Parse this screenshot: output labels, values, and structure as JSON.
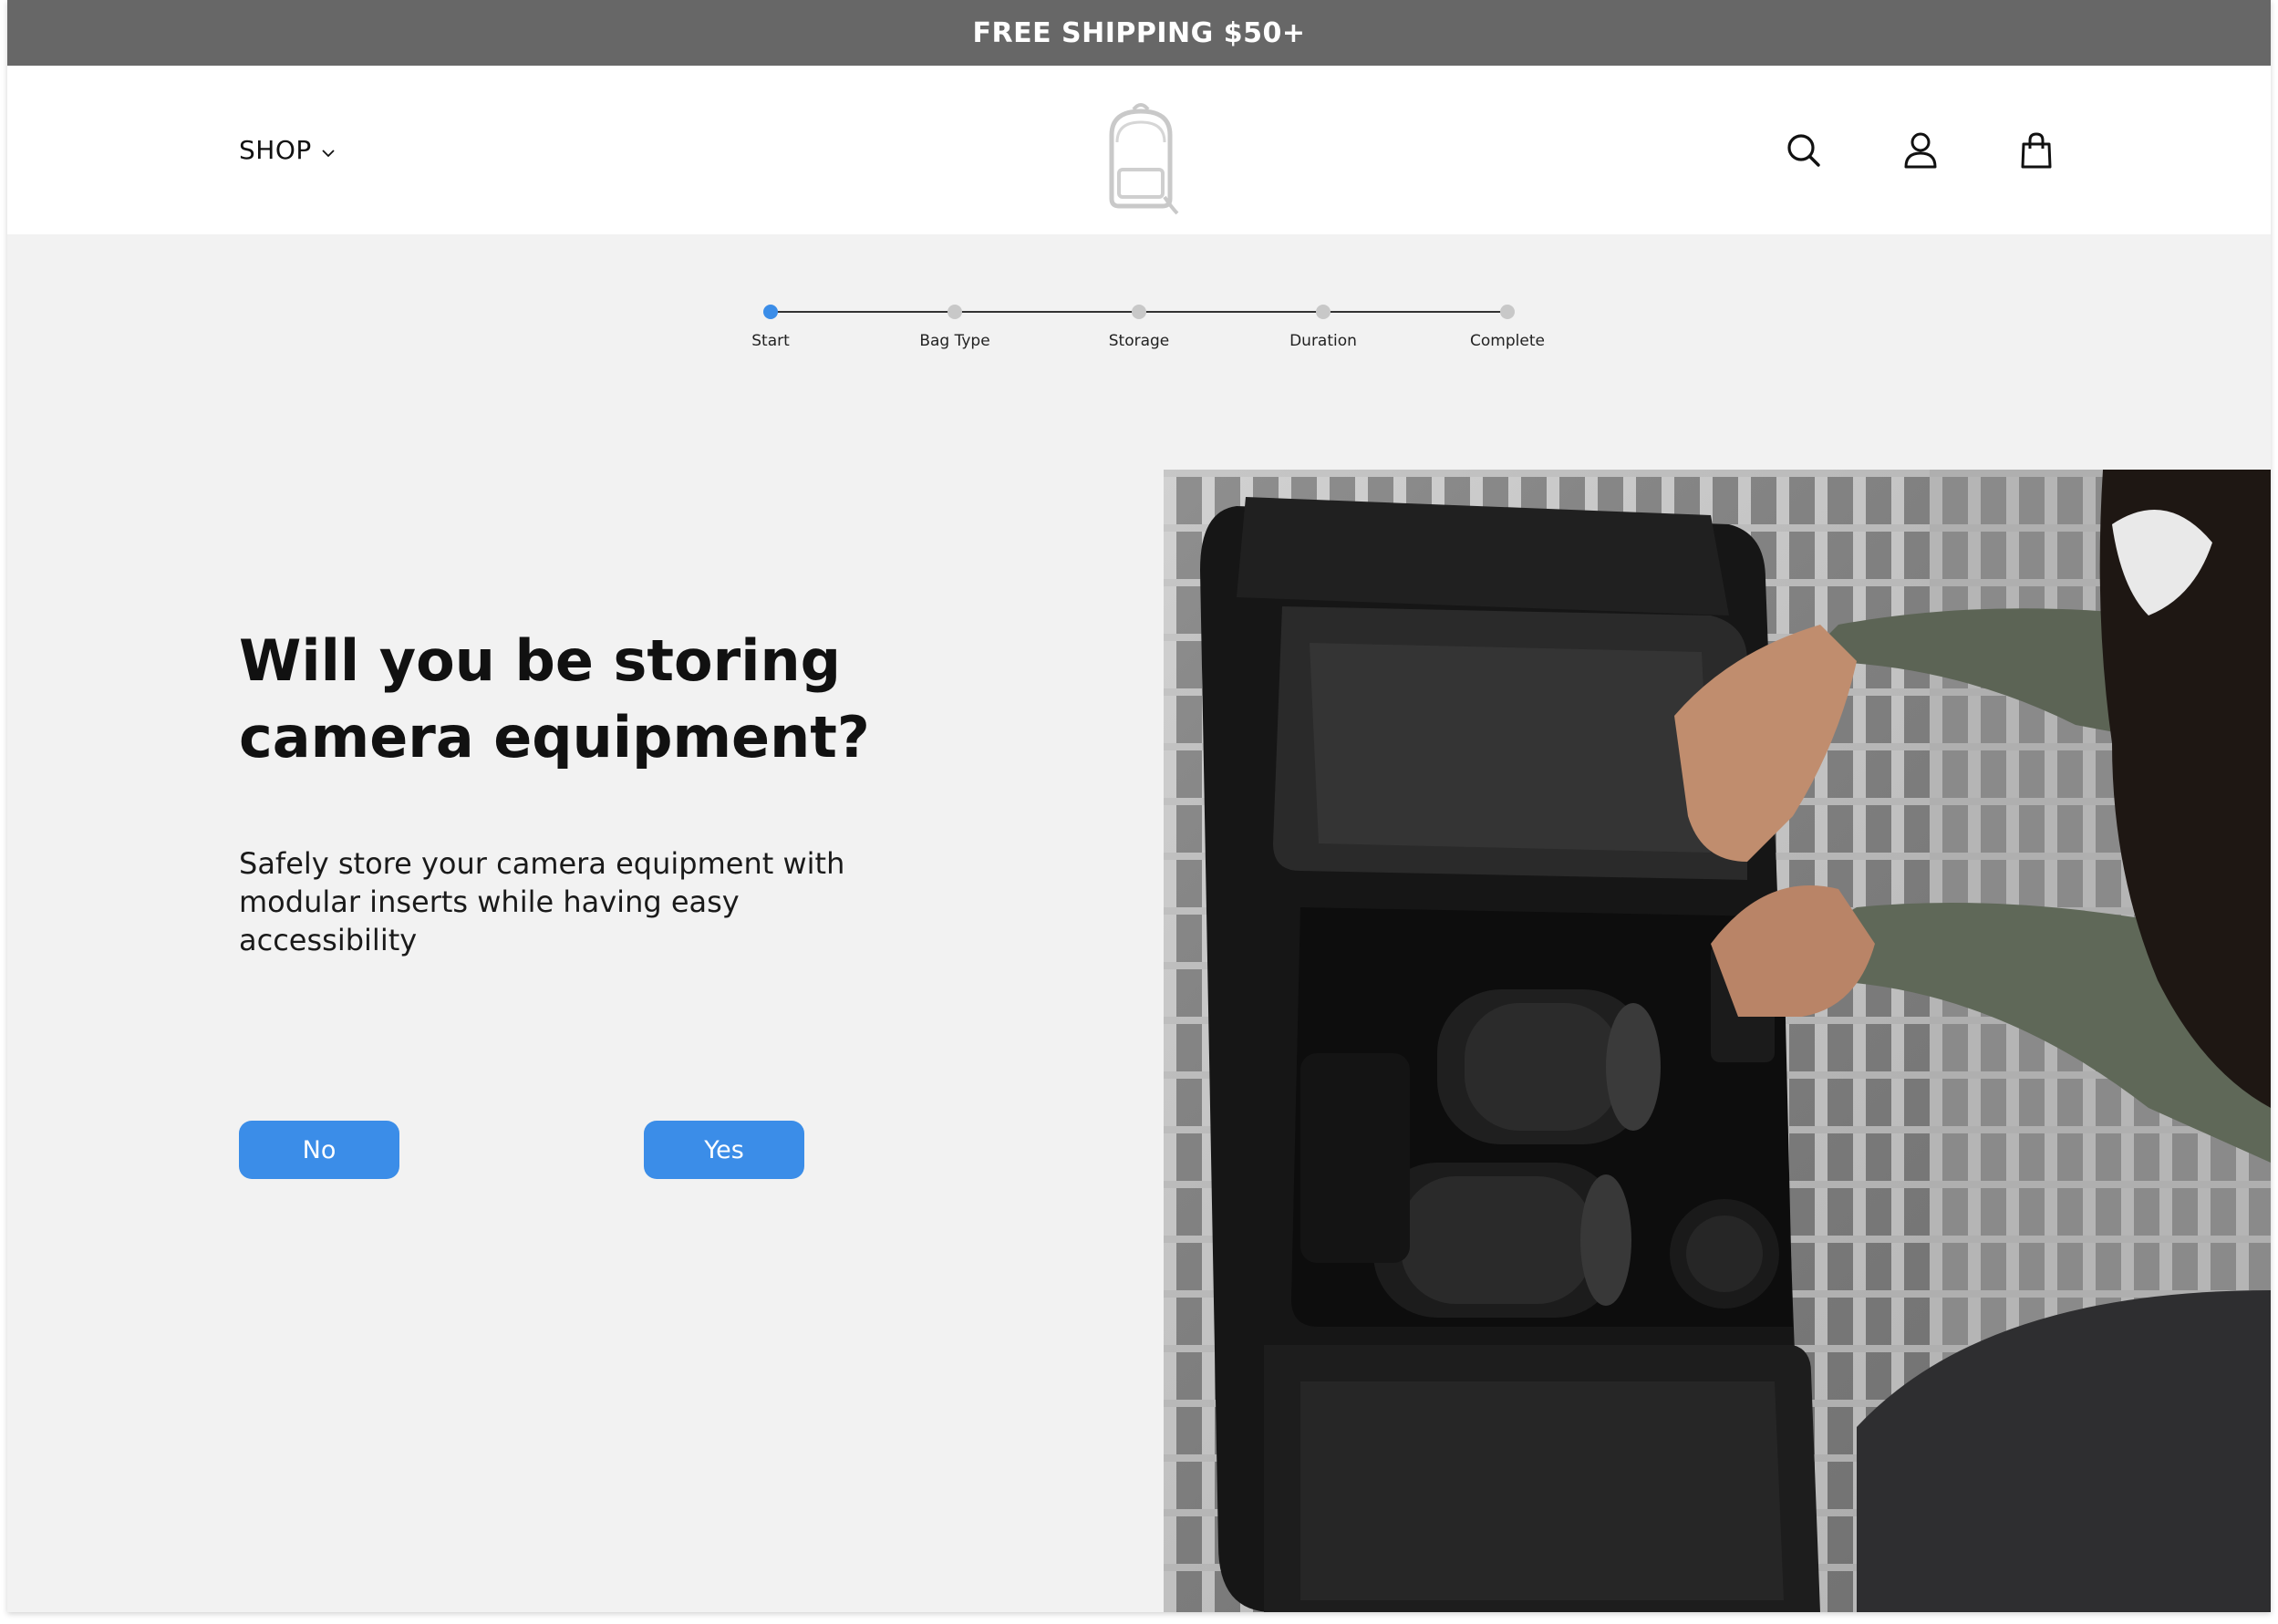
{
  "promo": {
    "text": "FREE SHIPPING $50+"
  },
  "header": {
    "shop_label": "SHOP",
    "icons": [
      "search-icon",
      "account-icon",
      "shopping-bag-icon"
    ]
  },
  "stepper": {
    "steps": [
      {
        "label": "Start",
        "active": true
      },
      {
        "label": "Bag Type",
        "active": false
      },
      {
        "label": "Storage",
        "active": false
      },
      {
        "label": "Duration",
        "active": false
      },
      {
        "label": "Complete",
        "active": false
      }
    ]
  },
  "question": {
    "title": "Will you be storing camera equipment?",
    "description": "Safely store your camera equipment with modular inserts while having easy accessibility"
  },
  "buttons": {
    "no": "No",
    "yes": "Yes"
  },
  "colors": {
    "accent": "#3b8de8",
    "promo_bar": "#676767",
    "page_bg": "#f2f2f2"
  }
}
